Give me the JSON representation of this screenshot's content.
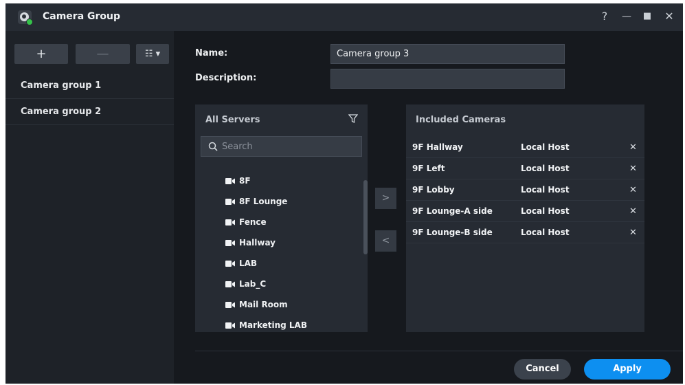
{
  "window": {
    "title": "Camera Group",
    "controls": {
      "help": "?",
      "minimize": "—",
      "maximize": "■",
      "close": "✕"
    }
  },
  "toolbar": {
    "add_label": "+",
    "remove_label": "—",
    "menu_label": "☷ ▾"
  },
  "groups": [
    {
      "label": "Camera group 1"
    },
    {
      "label": "Camera group 2"
    }
  ],
  "form": {
    "name_label": "Name:",
    "name_value": "Camera group 3",
    "description_label": "Description:",
    "description_value": ""
  },
  "servers_panel": {
    "title": "All Servers",
    "search_placeholder": "Search",
    "cameras": [
      "8F",
      "8F Lounge",
      "Fence",
      "Hallway",
      "LAB",
      "Lab_C",
      "Mail Room",
      "Marketing LAB"
    ]
  },
  "move_buttons": {
    "add": ">",
    "remove": "<"
  },
  "included_panel": {
    "title": "Included Cameras",
    "rows": [
      {
        "name": "9F Hallway",
        "server": "Local Host",
        "remove": "✕"
      },
      {
        "name": "9F Left",
        "server": "Local Host",
        "remove": "✕"
      },
      {
        "name": "9F Lobby",
        "server": "Local Host",
        "remove": "✕"
      },
      {
        "name": "9F Lounge-A side",
        "server": "Local Host",
        "remove": "✕"
      },
      {
        "name": "9F Lounge-B side",
        "server": "Local Host",
        "remove": "✕"
      }
    ]
  },
  "footer": {
    "cancel_label": "Cancel",
    "apply_label": "Apply"
  },
  "colors": {
    "accent": "#0d8ff0",
    "cancel": "#3b424c",
    "background": "#16191e"
  }
}
